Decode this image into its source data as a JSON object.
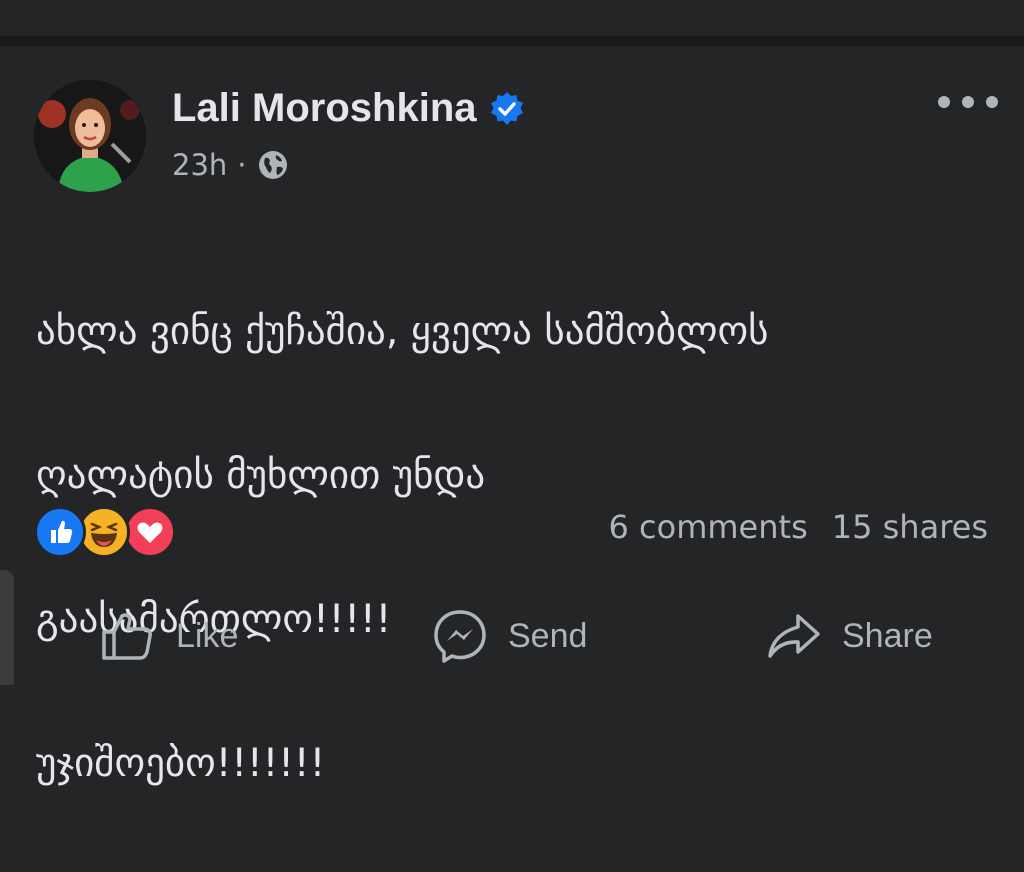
{
  "post": {
    "author": "Lali Moroshkina",
    "verified_icon": "verified-badge-icon",
    "time": "23h",
    "separator": "·",
    "audience_icon": "globe-icon",
    "more_icon": "more-options-icon",
    "text_lines": [
      "ახლა ვინც ქუჩაშია, ყველა სამშობლოს",
      "ღალატის მუხლით უნდა",
      "გაასამართლო!!!!!",
      "უჯიშოებო!!!!!!!"
    ]
  },
  "stats": {
    "reactions": [
      "like-reaction-icon",
      "haha-reaction-icon",
      "love-reaction-icon"
    ],
    "comments": "6 comments",
    "shares": "15 shares"
  },
  "actions": {
    "like": "Like",
    "send": "Send",
    "share": "Share"
  },
  "colors": {
    "background": "#242526",
    "divider": "#18191a",
    "text_primary": "#e4e6eb",
    "text_secondary": "#b0b3b8",
    "brand_blue": "#1877f2",
    "love_red": "#f33e58",
    "haha_yellow": "#f7b125"
  }
}
